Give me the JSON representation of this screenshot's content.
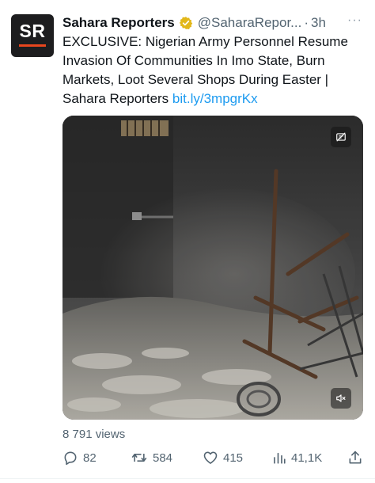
{
  "tweet": {
    "avatar_text": "SR",
    "display_name": "Sahara Reporters",
    "handle": "@SaharaRepor...",
    "separator": "·",
    "time": "3h",
    "more_label": "···",
    "text": "EXCLUSIVE: Nigerian Army Personnel Resume Invasion Of Communities In Imo State, Burn Markets, Loot Several Shops During Easter | Sahara Reporters ",
    "link": "bit.ly/3mpgrKx",
    "views_text": "8 791 views"
  },
  "actions": {
    "replies": "82",
    "retweets": "584",
    "likes": "415",
    "views": "41,1K"
  },
  "icons": {
    "verified": "verified-badge-icon",
    "more": "more-options-icon",
    "media_top": "media-options-icon",
    "media_bottom": "mute-icon",
    "reply": "reply-icon",
    "retweet": "retweet-icon",
    "like": "like-icon",
    "views": "views-chart-icon",
    "share": "share-icon"
  },
  "colors": {
    "link": "#1d9bf0",
    "verified": "#e2b719",
    "brand_bar": "#e8461e",
    "secondary_text": "#536471"
  }
}
